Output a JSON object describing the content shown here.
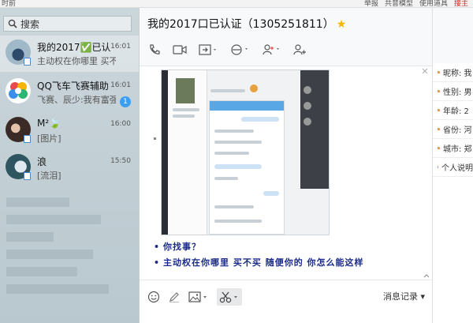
{
  "topbar": {
    "left_text": "时前",
    "right_items": [
      "举报",
      "共音模型",
      "使用道具",
      "接主"
    ]
  },
  "search": {
    "placeholder": "搜索"
  },
  "contacts": [
    {
      "name": "我的2017✅已认",
      "message": "主动权在你哪里 买不买 随",
      "time": "16:01"
    },
    {
      "name": "QQ飞车飞赛辅助",
      "message": "飞赛、辰少:我有富强",
      "time": "16:01",
      "unread": "1"
    },
    {
      "name": "M²🍃",
      "message": "[图片]",
      "time": "16:00"
    },
    {
      "name": "浪",
      "message": "[流泪]",
      "time": "15:50"
    }
  ],
  "chat": {
    "title": "我的2017口已认证（1305251811）",
    "vip_icon": "★",
    "messages": [
      "你找事？",
      "主动权在你哪里 买不买 随便你的 你怎么能这样"
    ],
    "history_label": "消息记录"
  },
  "info_panel": {
    "rows": [
      "昵称: 我",
      "性别: 男",
      "年龄: 2",
      "省份: 河",
      "城市: 郑",
      "个人说明"
    ]
  },
  "colors": {
    "accent": "#3d9df1",
    "vip": "#f4b400",
    "message_text": "#1a2a8a"
  }
}
